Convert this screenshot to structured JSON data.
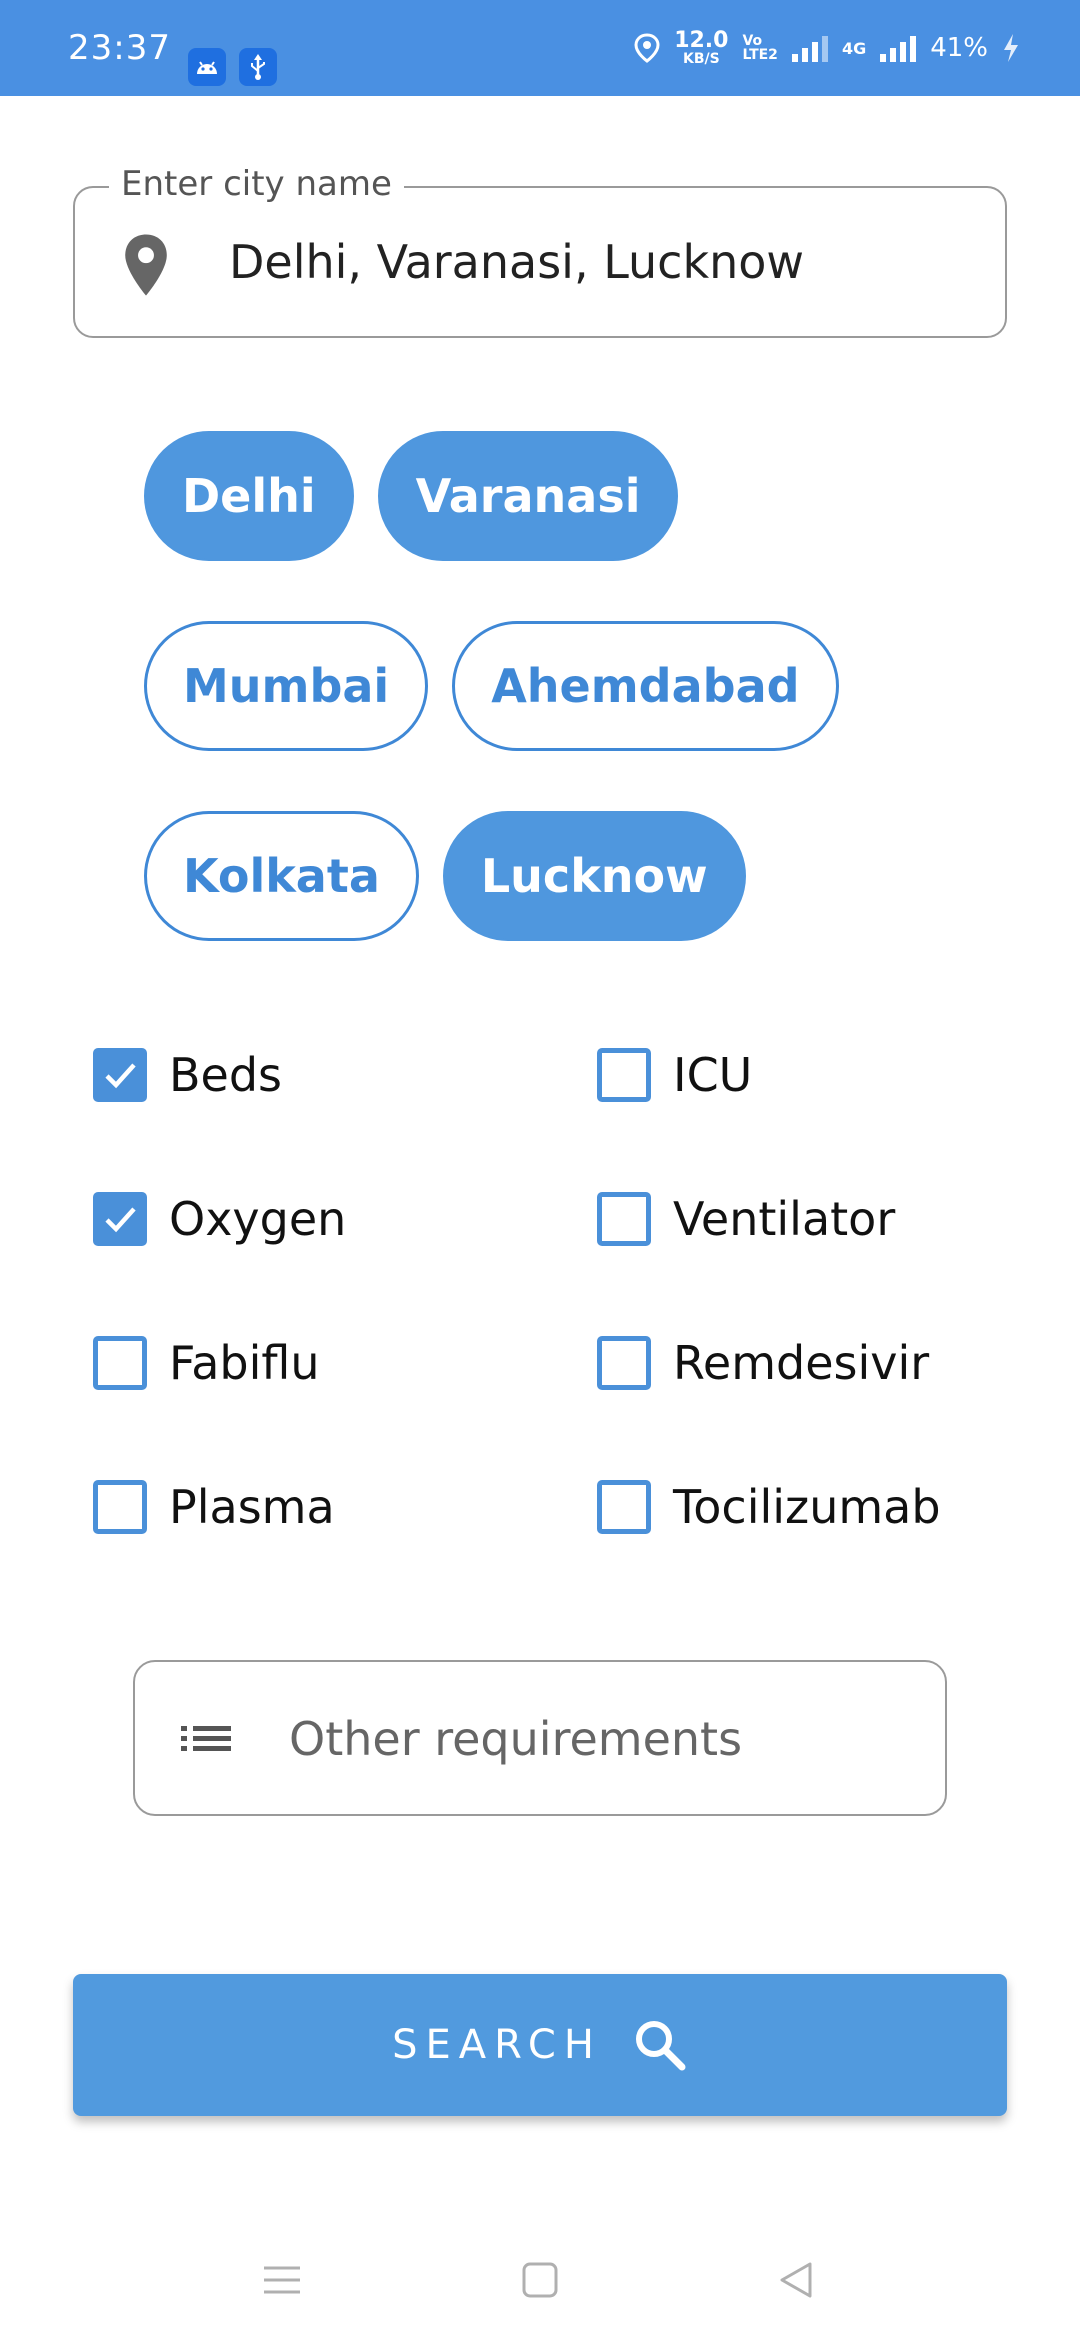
{
  "status_bar": {
    "time": "23:37",
    "speed_value": "12.0",
    "speed_unit": "KB/S",
    "volte_top": "Vo",
    "volte_bottom": "LTE2",
    "network": "4G",
    "battery": "41%",
    "icons": [
      "android-icon",
      "usb-icon",
      "location-icon",
      "signal-icon",
      "battery-charging-icon"
    ]
  },
  "city_field": {
    "label": "Enter city name",
    "value": "Delhi, Varanasi, Lucknow",
    "icon": "location-pin-icon"
  },
  "city_chips": [
    {
      "label": "Delhi",
      "selected": true
    },
    {
      "label": "Varanasi",
      "selected": true
    },
    {
      "label": "Mumbai",
      "selected": false
    },
    {
      "label": "Ahemdabad",
      "selected": false
    },
    {
      "label": "Kolkata",
      "selected": false
    },
    {
      "label": "Lucknow",
      "selected": true
    }
  ],
  "requirements": [
    {
      "label": "Beds",
      "checked": true
    },
    {
      "label": "ICU",
      "checked": false
    },
    {
      "label": "Oxygen",
      "checked": true
    },
    {
      "label": "Ventilator",
      "checked": false
    },
    {
      "label": "Fabiflu",
      "checked": false
    },
    {
      "label": "Remdesivir",
      "checked": false
    },
    {
      "label": "Plasma",
      "checked": false
    },
    {
      "label": "Tocilizumab",
      "checked": false
    }
  ],
  "other_requirements": {
    "placeholder": "Other requirements",
    "value": "",
    "icon": "list-icon"
  },
  "search_button": {
    "label": "SEARCH",
    "icon": "search-icon"
  },
  "nav_bar": {
    "items": [
      "menu-icon",
      "home-icon",
      "back-icon"
    ]
  },
  "colors": {
    "primary": "#4a90e2",
    "chip_selected": "#4f97de",
    "chip_border": "#3f88d6",
    "checkbox": "#4a90d9",
    "button": "#519ade"
  }
}
